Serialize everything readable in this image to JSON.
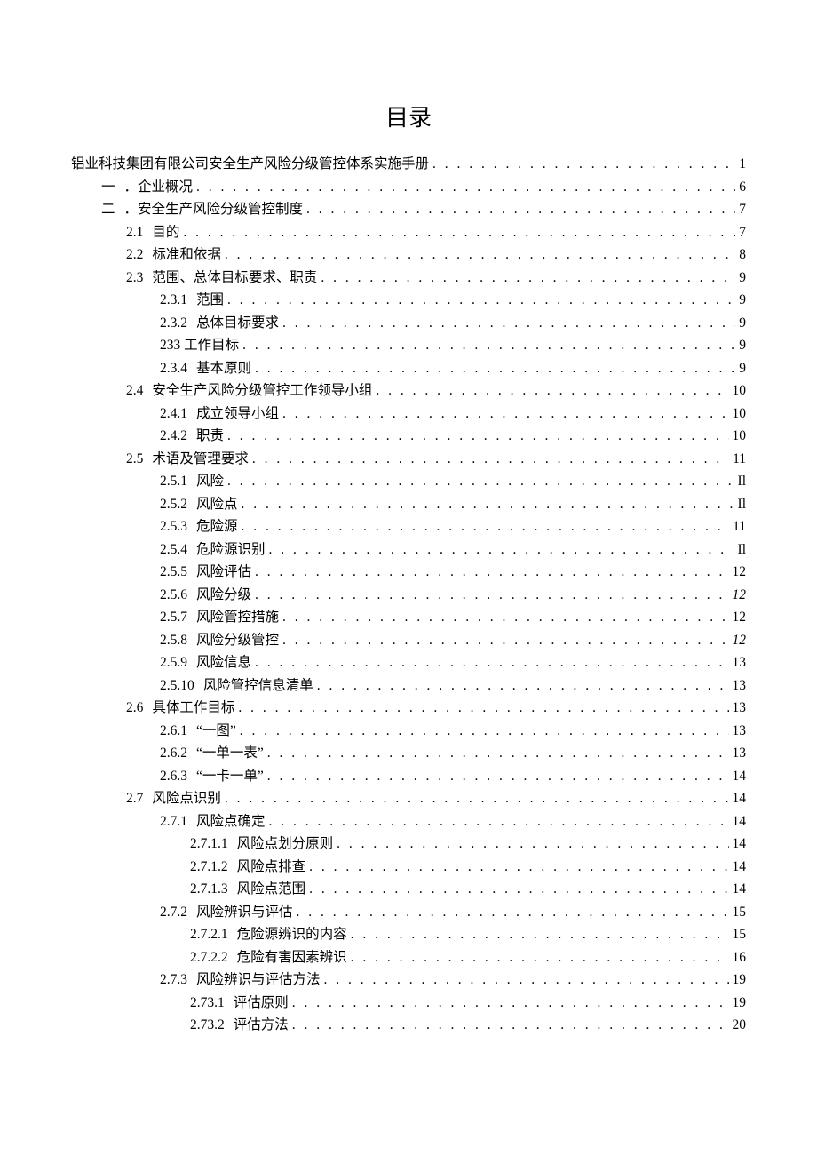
{
  "title": "目录",
  "entries": [
    {
      "indent": 0,
      "num": "",
      "label": "铝业科技集团有限公司安全生产风险分级管控体系实施手册",
      "page": "1",
      "italic": false
    },
    {
      "indent": 1,
      "num": "一",
      "label": "．企业概况",
      "page": "6",
      "italic": false
    },
    {
      "indent": 1,
      "num": "二",
      "label": "．安全生产风险分级管控制度",
      "page": "7",
      "italic": false
    },
    {
      "indent": 2,
      "num": "2.1",
      "label": "目的",
      "page": "7",
      "italic": false
    },
    {
      "indent": 2,
      "num": "2.2",
      "label": "标准和依据",
      "page": "8",
      "italic": false
    },
    {
      "indent": 2,
      "num": "2.3",
      "label": "范围、总体目标要求、职责",
      "page": "9",
      "italic": false
    },
    {
      "indent": 3,
      "num": "2.3.1",
      "label": "范围",
      "page": "9",
      "italic": false
    },
    {
      "indent": 3,
      "num": "2.3.2",
      "label": "总体目标要求",
      "page": "9",
      "italic": false
    },
    {
      "indent": 3,
      "num": "",
      "label": "233 工作目标",
      "page": "9",
      "italic": false
    },
    {
      "indent": 3,
      "num": "2.3.4",
      "label": "基本原则",
      "page": "9",
      "italic": false
    },
    {
      "indent": 2,
      "num": "2.4",
      "label": "安全生产风险分级管控工作领导小组",
      "page": "10",
      "italic": false
    },
    {
      "indent": 3,
      "num": "2.4.1",
      "label": "成立领导小组",
      "page": "10",
      "italic": false
    },
    {
      "indent": 3,
      "num": "2.4.2",
      "label": "职责",
      "page": "10",
      "italic": false
    },
    {
      "indent": 2,
      "num": "2.5",
      "label": "术语及管理要求",
      "page": "11",
      "italic": false
    },
    {
      "indent": 3,
      "num": "2.5.1",
      "label": "风险",
      "page": "Il",
      "italic": false
    },
    {
      "indent": 3,
      "num": "2.5.2",
      "label": "风险点",
      "page": "Il",
      "italic": false
    },
    {
      "indent": 3,
      "num": "2.5.3",
      "label": "危险源",
      "page": "11",
      "italic": false
    },
    {
      "indent": 3,
      "num": "2.5.4",
      "label": "危险源识别",
      "page": "Il",
      "italic": false
    },
    {
      "indent": 3,
      "num": "2.5.5",
      "label": "风险评估",
      "page": "12",
      "italic": false
    },
    {
      "indent": 3,
      "num": "2.5.6",
      "label": "风险分级",
      "page": "12",
      "italic": true
    },
    {
      "indent": 3,
      "num": "2.5.7",
      "label": "风险管控措施",
      "page": "12",
      "italic": false
    },
    {
      "indent": 3,
      "num": "2.5.8",
      "label": "风险分级管控",
      "page": "12",
      "italic": true
    },
    {
      "indent": 3,
      "num": "2.5.9",
      "label": "风险信息",
      "page": "13",
      "italic": false
    },
    {
      "indent": 3,
      "num": "2.5.10",
      "label": "风险管控信息清单",
      "page": "13",
      "italic": false
    },
    {
      "indent": 2,
      "num": "2.6",
      "label": "具体工作目标",
      "page": "13",
      "italic": false
    },
    {
      "indent": 3,
      "num": "2.6.1",
      "label": "“一图”",
      "page": "13",
      "italic": false
    },
    {
      "indent": 3,
      "num": "2.6.2",
      "label": "“一单一表”",
      "page": "13",
      "italic": false
    },
    {
      "indent": 3,
      "num": "2.6.3",
      "label": "“一卡一单”",
      "page": "14",
      "italic": false
    },
    {
      "indent": 2,
      "num": "2.7",
      "label": "风险点识别",
      "page": "14",
      "italic": false
    },
    {
      "indent": 3,
      "num": "2.7.1",
      "label": "风险点确定",
      "page": "14",
      "italic": false
    },
    {
      "indent": 4,
      "num": "2.7.1.1",
      "label": "风险点划分原则",
      "page": "14",
      "italic": false
    },
    {
      "indent": 4,
      "num": "2.7.1.2",
      "label": "风险点排查",
      "page": "14",
      "italic": false
    },
    {
      "indent": 4,
      "num": "2.7.1.3",
      "label": "风险点范围",
      "page": "14",
      "italic": false
    },
    {
      "indent": 3,
      "num": "2.7.2",
      "label": "风险辨识与评估",
      "page": "15",
      "italic": false
    },
    {
      "indent": 4,
      "num": "2.7.2.1",
      "label": "危险源辨识的内容",
      "page": "15",
      "italic": false
    },
    {
      "indent": 4,
      "num": "2.7.2.2",
      "label": "危险有害因素辨识",
      "page": "16",
      "italic": false
    },
    {
      "indent": 3,
      "num": "2.7.3",
      "label": "风险辨识与评估方法",
      "page": "19",
      "italic": false
    },
    {
      "indent": 4,
      "num": "2.73.1",
      "label": "评估原则",
      "page": "19",
      "italic": false
    },
    {
      "indent": 4,
      "num": "2.73.2",
      "label": "评估方法",
      "page": "20",
      "italic": false
    }
  ]
}
